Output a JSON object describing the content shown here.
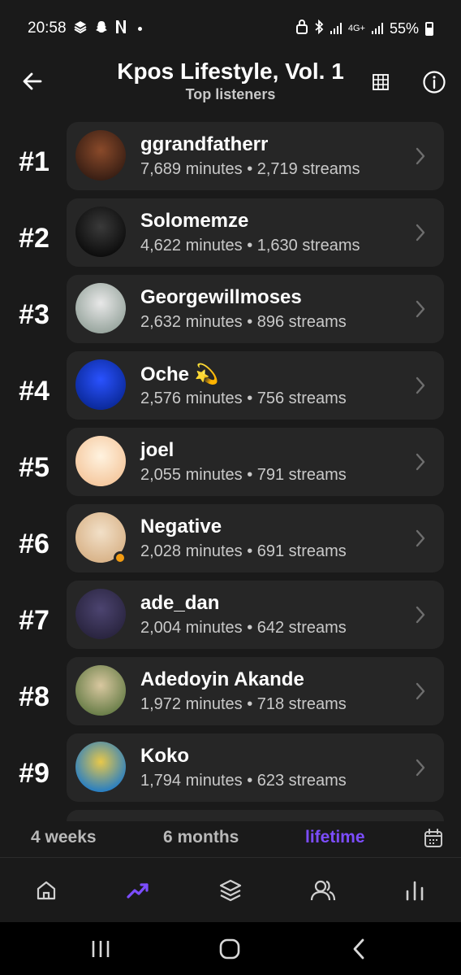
{
  "status_bar": {
    "time": "20:58",
    "left_icons": [
      "stack-icon",
      "snapchat-icon",
      "netflix-icon"
    ],
    "network": "4G+",
    "battery": "55%"
  },
  "header": {
    "title": "Kpos Lifestyle, Vol. 1",
    "subtitle": "Top listeners"
  },
  "listeners": [
    {
      "rank": "#1",
      "name": "ggrandfatherr",
      "meta": "7,689 minutes • 2,719 streams",
      "avatar_colors": [
        "#3a1f14",
        "#8a4a2a"
      ]
    },
    {
      "rank": "#2",
      "name": "Solomemze",
      "meta": "4,622 minutes • 1,630 streams",
      "avatar_colors": [
        "#0d0d0d",
        "#3a3a3a"
      ]
    },
    {
      "rank": "#3",
      "name": "Georgewillmoses",
      "meta": "2,632 minutes • 896 streams",
      "avatar_colors": [
        "#9aa7a0",
        "#e8e8e8"
      ]
    },
    {
      "rank": "#4",
      "name": "Oche 💫",
      "meta": "2,576 minutes • 756 streams",
      "avatar_colors": [
        "#0b2a9c",
        "#2a52ff"
      ]
    },
    {
      "rank": "#5",
      "name": "joel",
      "meta": "2,055 minutes • 791 streams",
      "avatar_colors": [
        "#f5c9a0",
        "#fff3e0"
      ]
    },
    {
      "rank": "#6",
      "name": "Negative",
      "meta": "2,028 minutes • 691 streams",
      "avatar_colors": [
        "#d9b48a",
        "#f2e0c8"
      ]
    },
    {
      "rank": "#7",
      "name": "ade_dan",
      "meta": "2,004 minutes • 642 streams",
      "avatar_colors": [
        "#2a2540",
        "#4c4470"
      ]
    },
    {
      "rank": "#8",
      "name": "Adedoyin Akande",
      "meta": "1,972 minutes • 718 streams",
      "avatar_colors": [
        "#6b7f4a",
        "#d9c8a0"
      ]
    },
    {
      "rank": "#9",
      "name": "Koko",
      "meta": "1,794 minutes • 623 streams",
      "avatar_colors": [
        "#2a7fc1",
        "#e8c84a"
      ]
    }
  ],
  "time_range": {
    "options": [
      "4 weeks",
      "6 months",
      "lifetime"
    ],
    "selected": "lifetime"
  },
  "bottom_nav": {
    "items": [
      "home-icon",
      "trending-icon",
      "layers-icon",
      "users-icon",
      "stats-icon"
    ],
    "active": "trending-icon"
  },
  "colors": {
    "accent": "#7c4dff",
    "background": "#1a1a1a",
    "card": "#262626"
  }
}
